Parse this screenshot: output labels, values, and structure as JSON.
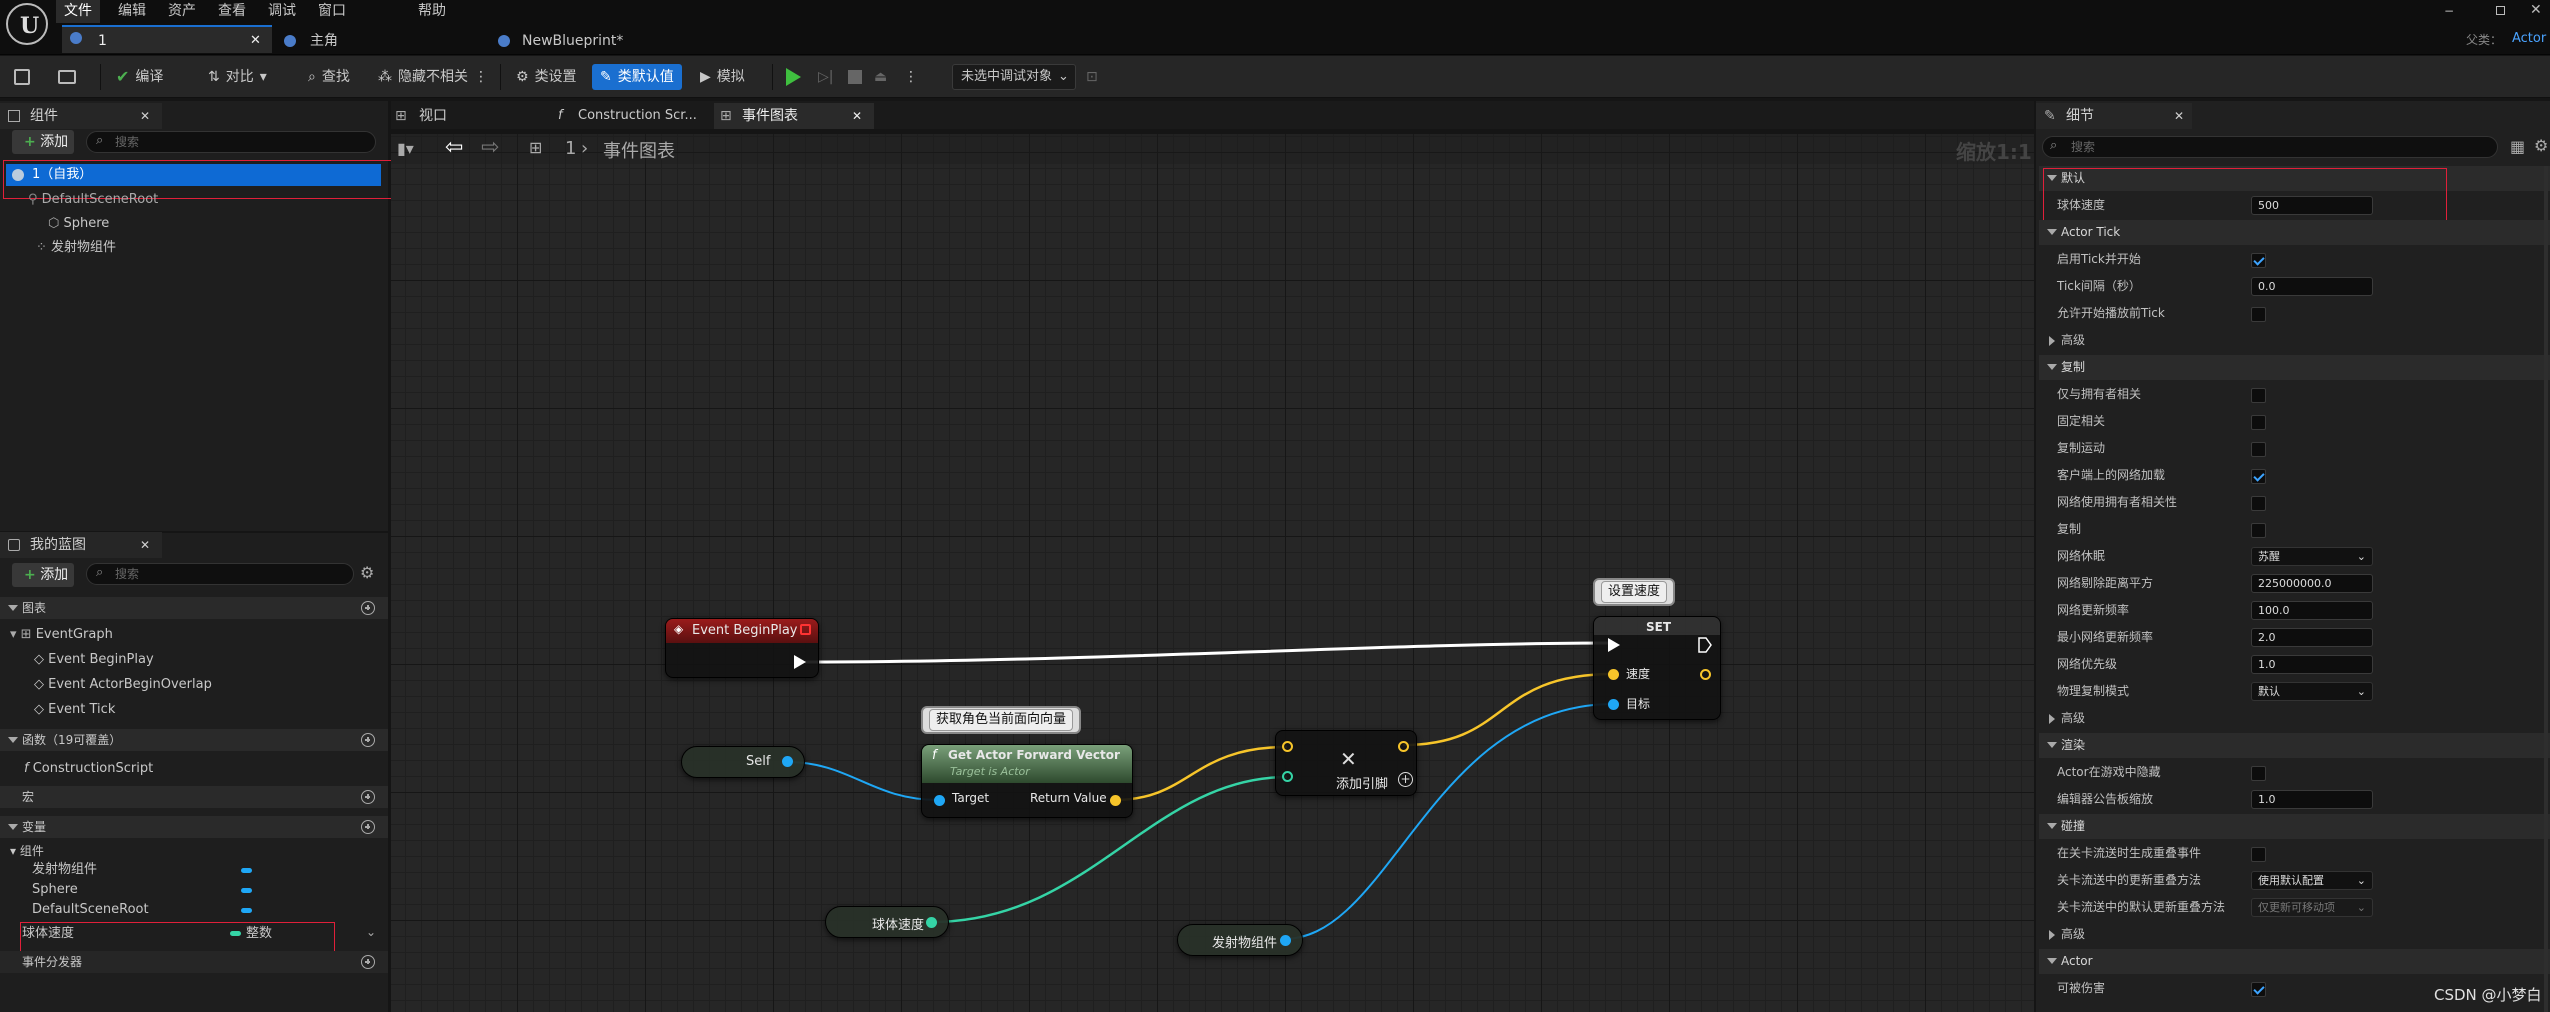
{
  "menu": {
    "items": [
      "文件",
      "编辑",
      "资产",
      "查看",
      "调试",
      "窗口",
      "帮助"
    ]
  },
  "parent": {
    "label": "父类：",
    "value": "Actor"
  },
  "doc_tabs": [
    "1",
    "主角",
    "NewBlueprint*"
  ],
  "toolbar": {
    "compile": "编译",
    "diff": "对比",
    "find": "查找",
    "hide_unrelated": "隐藏不相关",
    "class_settings": "类设置",
    "class_defaults": "类默认值",
    "simulate": "模拟",
    "debug_target": "未选中调试对象"
  },
  "components": {
    "title": "组件",
    "add": "添加",
    "search_placeholder": "搜索",
    "items": [
      {
        "label": "1（自我）"
      },
      {
        "label": "DefaultSceneRoot"
      },
      {
        "label": "Sphere"
      },
      {
        "label": "发射物组件"
      }
    ]
  },
  "graph_tabs": [
    "视口",
    "Construction Scr...",
    "事件图表"
  ],
  "graph": {
    "breadcrumb_root": "1",
    "breadcrumb_page": "事件图表",
    "zoom": "缩放1:1"
  },
  "nodes": {
    "begin_play": {
      "title": "Event BeginPlay"
    },
    "self": {
      "title": "Self"
    },
    "forward": {
      "title": "Get Actor Forward Vector",
      "subtitle": "Target is Actor",
      "comment": "获取角色当前面向向量",
      "target": "Target",
      "return": "Return Value"
    },
    "add": {
      "title": "添加引脚"
    },
    "speed": {
      "title": "球体速度"
    },
    "proj": {
      "title": "发射物组件"
    },
    "set": {
      "title": "SET",
      "comment": "设置速度",
      "speed": "速度",
      "target": "目标"
    }
  },
  "my_blueprint": {
    "title": "我的蓝图",
    "add": "添加",
    "search_placeholder": "搜索",
    "graphs": "图表",
    "event_graph": "EventGraph",
    "events": [
      "Event BeginPlay",
      "Event ActorBeginOverlap",
      "Event Tick"
    ],
    "functions": "函数（19可覆盖）",
    "construction": "ConstructionScript",
    "macros": "宏",
    "variables": "变量",
    "components_cat": "组件",
    "var_components": [
      "发射物组件",
      "Sphere",
      "DefaultSceneRoot"
    ],
    "var_speed": {
      "name": "球体速度",
      "type": "整数"
    },
    "dispatchers": "事件分发器"
  },
  "details": {
    "title": "细节",
    "search_placeholder": "搜索",
    "default_cat": "默认",
    "speed_label": "球体速度",
    "speed_value": "500",
    "actor_tick": "Actor Tick",
    "tick_start": "启用Tick并开始",
    "tick_interval": "Tick间隔（秒）",
    "tick_interval_value": "0.0",
    "tick_before_begin": "允许开始播放前Tick",
    "advanced": "高级",
    "replication": "复制",
    "only_owner": "仅与拥有者相关",
    "always_relevant": "固定相关",
    "replicate_movement": "复制运动",
    "net_load_client": "客户端上的网络加载",
    "net_use_owner": "网络使用拥有者相关性",
    "replicates": "复制",
    "dormancy": "网络休眠",
    "dormancy_value": "苏醒",
    "cull_dist": "网络剔除距离平方",
    "cull_dist_value": "225000000.0",
    "update_freq": "网络更新频率",
    "update_freq_value": "100.0",
    "min_update_freq": "最小网络更新频率",
    "min_update_freq_value": "2.0",
    "net_priority": "网络优先级",
    "net_priority_value": "1.0",
    "phys_rep": "物理复制模式",
    "phys_rep_value": "默认",
    "rendering": "渲染",
    "hidden_game": "Actor在游戏中隐藏",
    "billboard": "编辑器公告板缩放",
    "billboard_value": "1.0",
    "collision": "碰撞",
    "gen_overlap": "在关卡流送时生成重叠事件",
    "level_overlap": "关卡流送中的更新重叠方法",
    "level_overlap_value": "使用默认配置",
    "default_overlap": "关卡流送中的默认更新重叠方法",
    "default_overlap_value": "仅更新可移动项",
    "actor_cat": "Actor",
    "can_damage": "可被伤害"
  },
  "watermark": "CSDN @小梦白",
  "colors": {
    "accent": "#1a6fd0",
    "exec": "#ffffff",
    "vector": "#f7c52a",
    "float": "#35d4a6",
    "object": "#1fa7f5",
    "highlight": "#e0203a"
  }
}
